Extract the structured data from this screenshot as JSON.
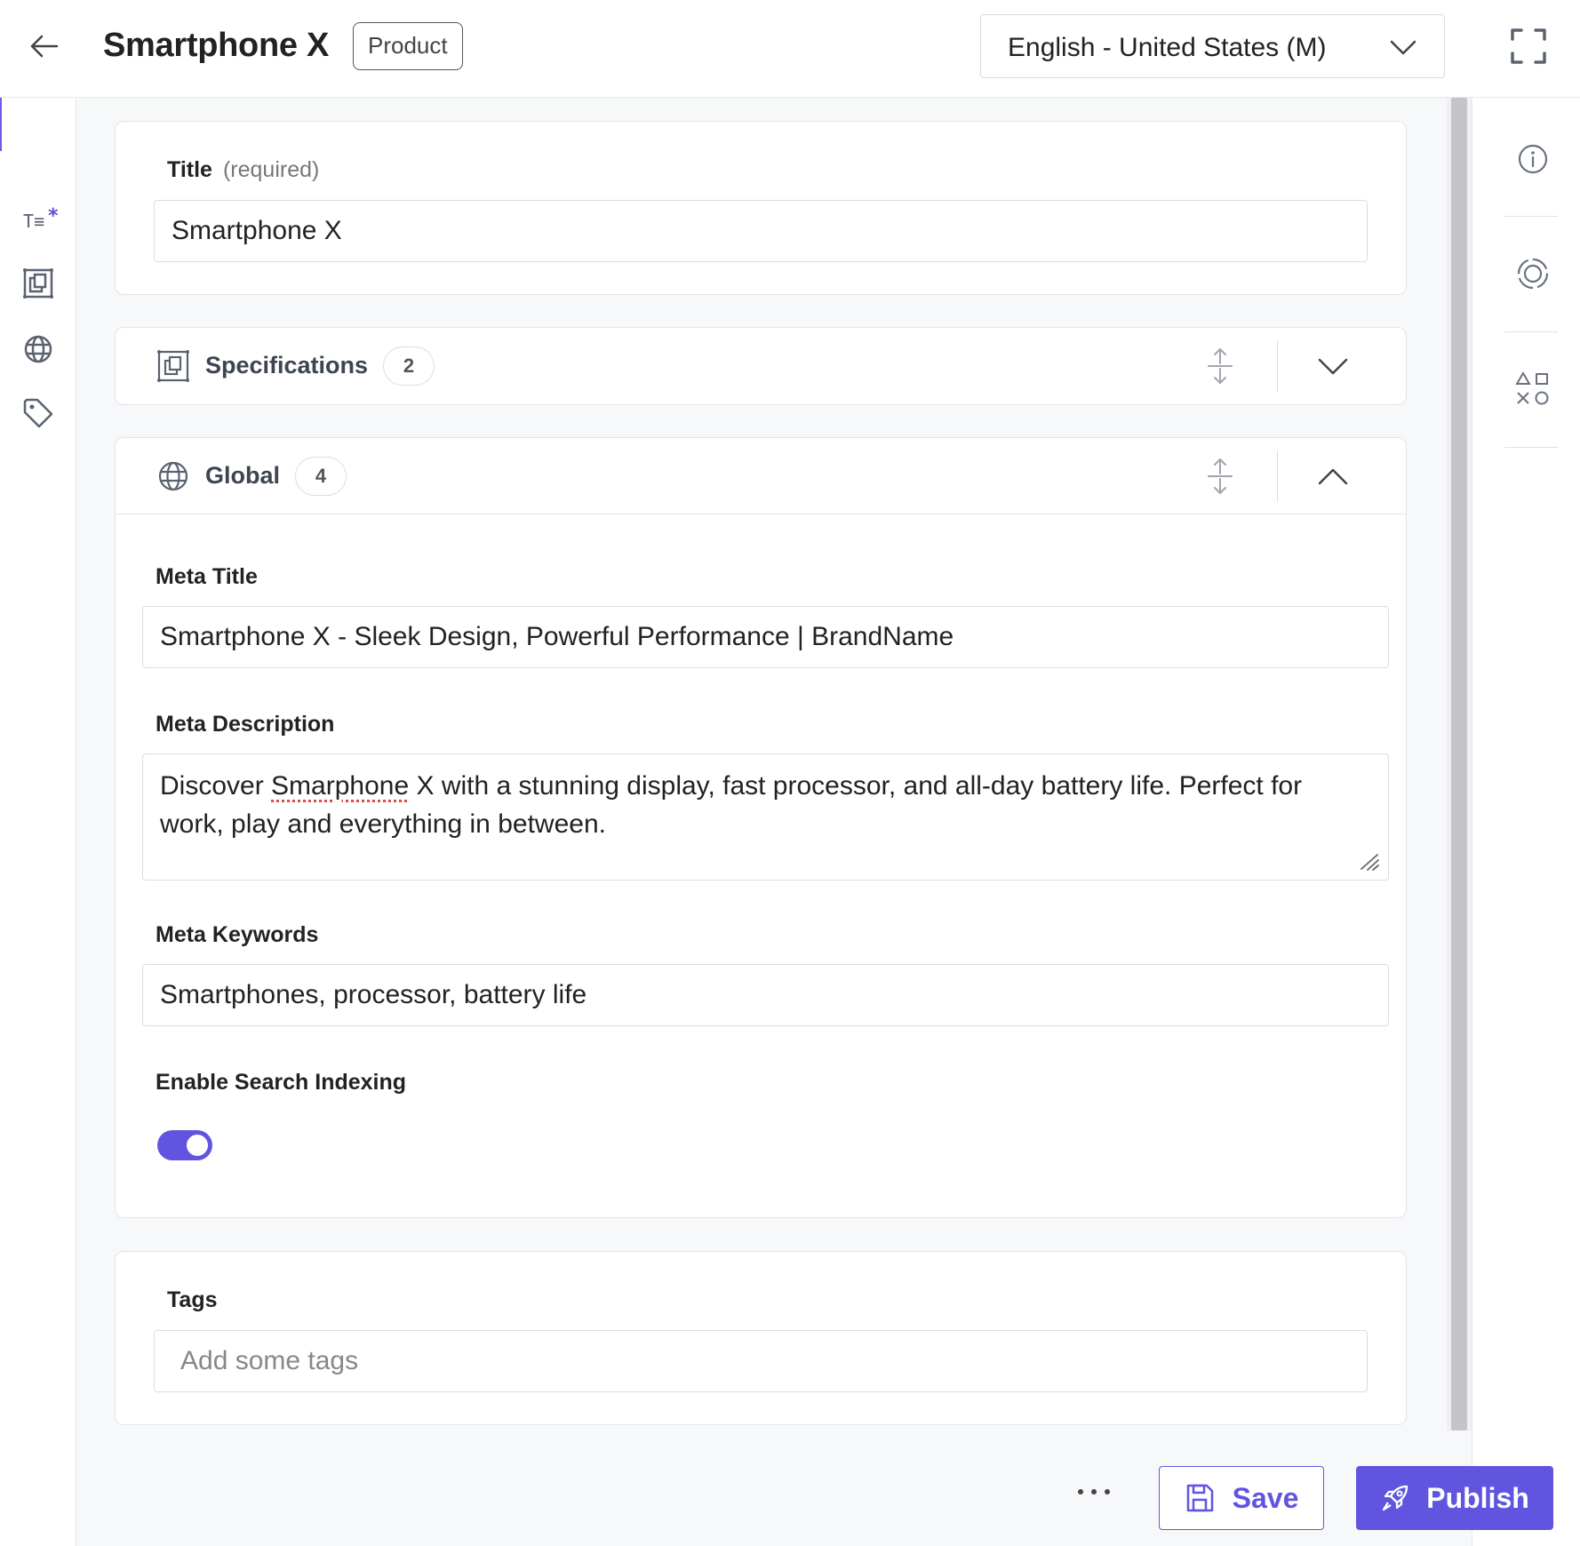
{
  "header": {
    "title": "Smartphone X",
    "content_type_badge": "Product",
    "locale": "English - United States (M)"
  },
  "left_nav": {
    "items": [
      {
        "name": "text-fields-icon"
      },
      {
        "name": "modular-block-icon"
      },
      {
        "name": "globe-icon"
      },
      {
        "name": "tag-icon"
      }
    ]
  },
  "right_nav": {
    "items": [
      {
        "name": "info-icon"
      },
      {
        "name": "target-icon"
      },
      {
        "name": "shapes-icon"
      }
    ]
  },
  "title_field": {
    "label": "Title",
    "required_note": "(required)",
    "value": "Smartphone X"
  },
  "specifications_group": {
    "title": "Specifications",
    "count": "2",
    "expanded": false
  },
  "global_group": {
    "title": "Global",
    "count": "4",
    "expanded": true,
    "meta_title": {
      "label": "Meta Title",
      "value": "Smartphone X - Sleek Design, Powerful Performance | BrandName"
    },
    "meta_description": {
      "label": "Meta Description",
      "value_before": "Discover ",
      "value_misspelled": "Smarphone",
      "value_after": " X with a stunning display, fast processor, and all-day battery life.  Perfect for work, play and everything in between."
    },
    "meta_keywords": {
      "label": "Meta Keywords",
      "value": "Smartphones, processor, battery life"
    },
    "search_indexing": {
      "label": "Enable Search Indexing",
      "enabled": true
    }
  },
  "tags_field": {
    "label": "Tags",
    "placeholder": "Add some tags"
  },
  "footer": {
    "save_label": "Save",
    "publish_label": "Publish"
  },
  "colors": {
    "accent": "#6155e0",
    "icon": "#5a6270",
    "border": "#dcdde2"
  }
}
